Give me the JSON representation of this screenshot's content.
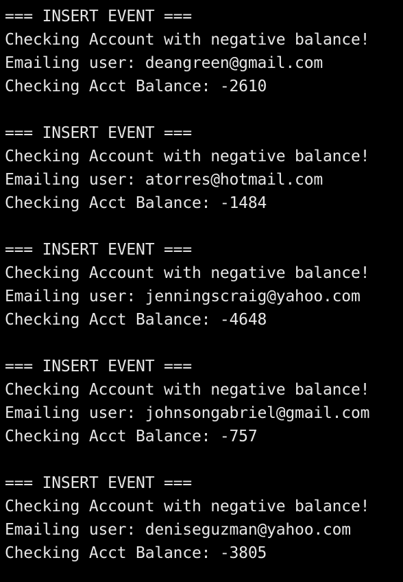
{
  "colors": {
    "background": "#000000",
    "text": "#e6e6e6"
  },
  "events": [
    {
      "header": "=== INSERT EVENT ===",
      "message": "Checking Account with negative balance!",
      "email_line": "Emailing user: deangreen@gmail.com",
      "balance_line": "Checking Acct Balance: -2610"
    },
    {
      "header": "=== INSERT EVENT ===",
      "message": "Checking Account with negative balance!",
      "email_line": "Emailing user: atorres@hotmail.com",
      "balance_line": "Checking Acct Balance: -1484"
    },
    {
      "header": "=== INSERT EVENT ===",
      "message": "Checking Account with negative balance!",
      "email_line": "Emailing user: jenningscraig@yahoo.com",
      "balance_line": "Checking Acct Balance: -4648"
    },
    {
      "header": "=== INSERT EVENT ===",
      "message": "Checking Account with negative balance!",
      "email_line": "Emailing user: johnsongabriel@gmail.com",
      "balance_line": "Checking Acct Balance: -757"
    },
    {
      "header": "=== INSERT EVENT ===",
      "message": "Checking Account with negative balance!",
      "email_line": "Emailing user: deniseguzman@yahoo.com",
      "balance_line": "Checking Acct Balance: -3805"
    }
  ]
}
